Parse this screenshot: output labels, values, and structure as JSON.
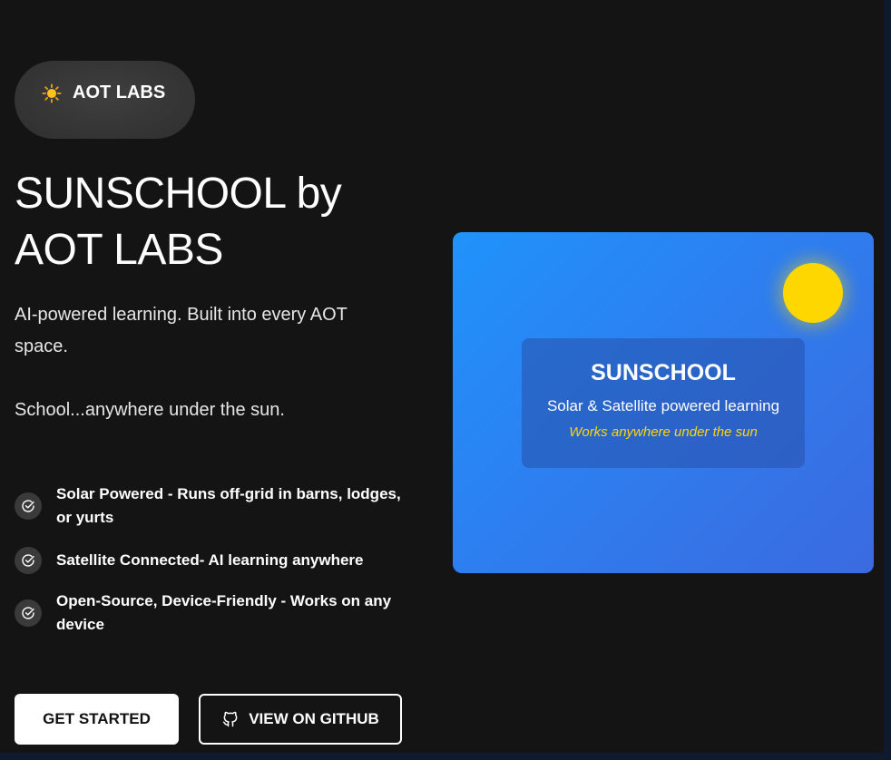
{
  "badge": {
    "emoji_icon": "sun-icon",
    "label": "AOT LABS"
  },
  "hero": {
    "title": "SUNSCHOOL by AOT LABS",
    "lead": "AI-powered learning. Built into every AOT space.",
    "lead2": "School...anywhere under the sun."
  },
  "features": [
    {
      "icon": "check-circle-icon",
      "text": "Solar Powered - Runs off-grid in barns, lodges, or yurts"
    },
    {
      "icon": "check-circle-icon",
      "text": "Satellite Connected- AI learning anywhere"
    },
    {
      "icon": "check-circle-icon",
      "text": "Open-Source, Device-Friendly - Works on any device"
    }
  ],
  "buttons": {
    "primary": "GET STARTED",
    "secondary": "VIEW ON GITHUB",
    "secondary_icon": "github-icon"
  },
  "card": {
    "title": "SUNSCHOOL",
    "subtitle": "Solar & Satellite powered learning",
    "tagline": "Works anywhere under the sun",
    "colors": {
      "gradient_start": "#2093fb",
      "gradient_end": "#3b6ae0",
      "sun": "#ffd700",
      "tagline": "#ffd700"
    }
  },
  "theme": {
    "background": "#141414",
    "badge_bg": "#353535",
    "check_bg": "#3a3a3a"
  }
}
